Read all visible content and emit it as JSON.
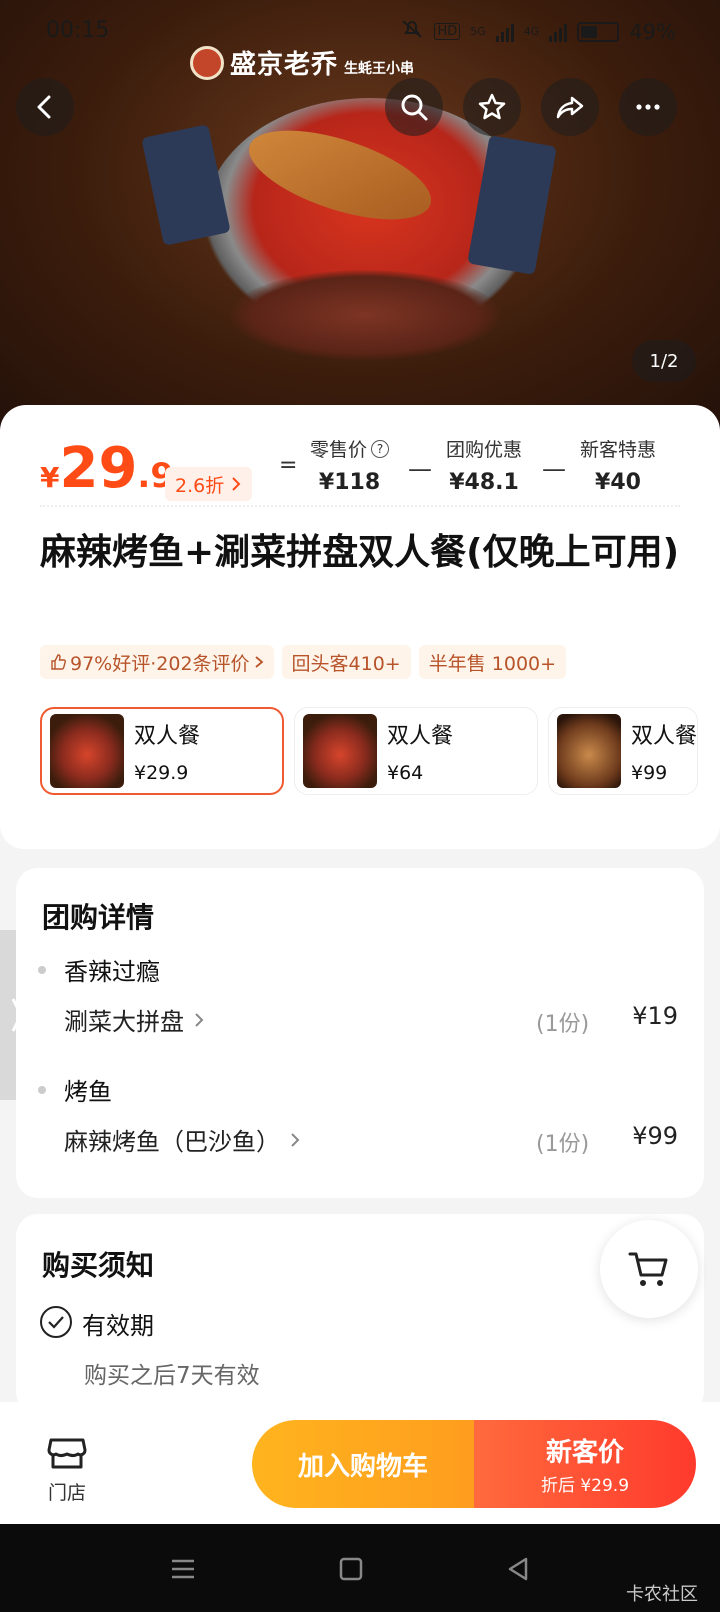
{
  "status_bar": {
    "time": "00:15",
    "battery": "49%",
    "hd": "HD",
    "net1": "5G",
    "net2": "4G"
  },
  "hero": {
    "brand_name": "盛京老乔",
    "brand_sub": "生蚝王小串",
    "page_indicator": "1/2"
  },
  "price": {
    "currency": "¥",
    "now_int": "29",
    "now_dec": ".9",
    "discount": "2.6折",
    "equals": "=",
    "minus": "—",
    "retail_label": "零售价",
    "retail_value": "¥118",
    "group_label": "团购优惠",
    "group_value": "¥48.1",
    "newcust_label": "新客特惠",
    "newcust_value": "¥40"
  },
  "title": "麻辣烤鱼+涮菜拼盘双人餐(仅晚上可用)",
  "tags": [
    "97%好评·202条评价",
    "回头客410+",
    "半年售 1000+"
  ],
  "packages": [
    {
      "name": "双人餐",
      "price": "¥29.9"
    },
    {
      "name": "双人餐",
      "price": "¥64"
    },
    {
      "name": "双人餐",
      "price": "¥99"
    }
  ],
  "details": {
    "title": "团购详情",
    "groups": [
      {
        "title": "香辣过瘾",
        "item": "涮菜大拼盘",
        "qty": "(1份)",
        "price": "¥19"
      },
      {
        "title": "烤鱼",
        "item": "麻辣烤鱼（巴沙鱼）",
        "qty": "(1份)",
        "price": "¥99"
      }
    ]
  },
  "notice": {
    "title": "购买须知",
    "validity_label": "有效期",
    "validity_text": "购买之后7天有效"
  },
  "bottom": {
    "store_label": "门店",
    "add_cart": "加入购物车",
    "buy_main": "新客价",
    "buy_sub": "折后 ¥29.9"
  },
  "watermark": "卡农社区",
  "colors": {
    "accent": "#ff4b16",
    "cart_button": "#ffa91e",
    "buy_button": "#ff4a33"
  }
}
